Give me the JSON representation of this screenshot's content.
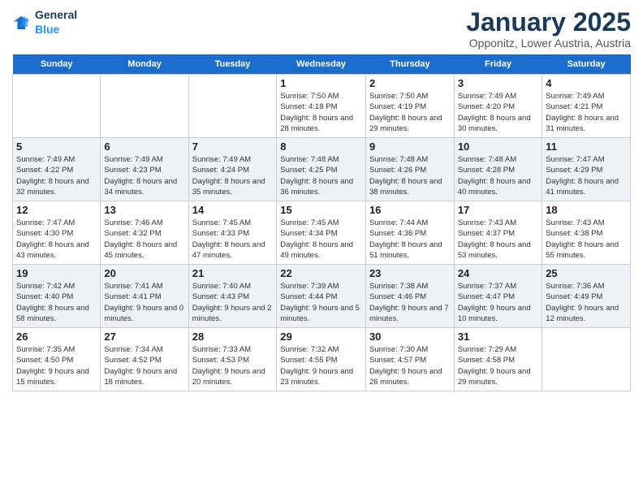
{
  "header": {
    "logo": {
      "general": "General",
      "blue": "Blue"
    },
    "title": "January 2025",
    "subtitle": "Opponitz, Lower Austria, Austria"
  },
  "calendar": {
    "days_of_week": [
      "Sunday",
      "Monday",
      "Tuesday",
      "Wednesday",
      "Thursday",
      "Friday",
      "Saturday"
    ],
    "weeks": [
      [
        {
          "day": "",
          "info": ""
        },
        {
          "day": "",
          "info": ""
        },
        {
          "day": "",
          "info": ""
        },
        {
          "day": "1",
          "info": "Sunrise: 7:50 AM\nSunset: 4:18 PM\nDaylight: 8 hours\nand 28 minutes."
        },
        {
          "day": "2",
          "info": "Sunrise: 7:50 AM\nSunset: 4:19 PM\nDaylight: 8 hours\nand 29 minutes."
        },
        {
          "day": "3",
          "info": "Sunrise: 7:49 AM\nSunset: 4:20 PM\nDaylight: 8 hours\nand 30 minutes."
        },
        {
          "day": "4",
          "info": "Sunrise: 7:49 AM\nSunset: 4:21 PM\nDaylight: 8 hours\nand 31 minutes."
        }
      ],
      [
        {
          "day": "5",
          "info": "Sunrise: 7:49 AM\nSunset: 4:22 PM\nDaylight: 8 hours\nand 32 minutes."
        },
        {
          "day": "6",
          "info": "Sunrise: 7:49 AM\nSunset: 4:23 PM\nDaylight: 8 hours\nand 34 minutes."
        },
        {
          "day": "7",
          "info": "Sunrise: 7:49 AM\nSunset: 4:24 PM\nDaylight: 8 hours\nand 35 minutes."
        },
        {
          "day": "8",
          "info": "Sunrise: 7:48 AM\nSunset: 4:25 PM\nDaylight: 8 hours\nand 36 minutes."
        },
        {
          "day": "9",
          "info": "Sunrise: 7:48 AM\nSunset: 4:26 PM\nDaylight: 8 hours\nand 38 minutes."
        },
        {
          "day": "10",
          "info": "Sunrise: 7:48 AM\nSunset: 4:28 PM\nDaylight: 8 hours\nand 40 minutes."
        },
        {
          "day": "11",
          "info": "Sunrise: 7:47 AM\nSunset: 4:29 PM\nDaylight: 8 hours\nand 41 minutes."
        }
      ],
      [
        {
          "day": "12",
          "info": "Sunrise: 7:47 AM\nSunset: 4:30 PM\nDaylight: 8 hours\nand 43 minutes."
        },
        {
          "day": "13",
          "info": "Sunrise: 7:46 AM\nSunset: 4:32 PM\nDaylight: 8 hours\nand 45 minutes."
        },
        {
          "day": "14",
          "info": "Sunrise: 7:45 AM\nSunset: 4:33 PM\nDaylight: 8 hours\nand 47 minutes."
        },
        {
          "day": "15",
          "info": "Sunrise: 7:45 AM\nSunset: 4:34 PM\nDaylight: 8 hours\nand 49 minutes."
        },
        {
          "day": "16",
          "info": "Sunrise: 7:44 AM\nSunset: 4:36 PM\nDaylight: 8 hours\nand 51 minutes."
        },
        {
          "day": "17",
          "info": "Sunrise: 7:43 AM\nSunset: 4:37 PM\nDaylight: 8 hours\nand 53 minutes."
        },
        {
          "day": "18",
          "info": "Sunrise: 7:43 AM\nSunset: 4:38 PM\nDaylight: 8 hours\nand 55 minutes."
        }
      ],
      [
        {
          "day": "19",
          "info": "Sunrise: 7:42 AM\nSunset: 4:40 PM\nDaylight: 8 hours\nand 58 minutes."
        },
        {
          "day": "20",
          "info": "Sunrise: 7:41 AM\nSunset: 4:41 PM\nDaylight: 9 hours\nand 0 minutes."
        },
        {
          "day": "21",
          "info": "Sunrise: 7:40 AM\nSunset: 4:43 PM\nDaylight: 9 hours\nand 2 minutes."
        },
        {
          "day": "22",
          "info": "Sunrise: 7:39 AM\nSunset: 4:44 PM\nDaylight: 9 hours\nand 5 minutes."
        },
        {
          "day": "23",
          "info": "Sunrise: 7:38 AM\nSunset: 4:46 PM\nDaylight: 9 hours\nand 7 minutes."
        },
        {
          "day": "24",
          "info": "Sunrise: 7:37 AM\nSunset: 4:47 PM\nDaylight: 9 hours\nand 10 minutes."
        },
        {
          "day": "25",
          "info": "Sunrise: 7:36 AM\nSunset: 4:49 PM\nDaylight: 9 hours\nand 12 minutes."
        }
      ],
      [
        {
          "day": "26",
          "info": "Sunrise: 7:35 AM\nSunset: 4:50 PM\nDaylight: 9 hours\nand 15 minutes."
        },
        {
          "day": "27",
          "info": "Sunrise: 7:34 AM\nSunset: 4:52 PM\nDaylight: 9 hours\nand 18 minutes."
        },
        {
          "day": "28",
          "info": "Sunrise: 7:33 AM\nSunset: 4:53 PM\nDaylight: 9 hours\nand 20 minutes."
        },
        {
          "day": "29",
          "info": "Sunrise: 7:32 AM\nSunset: 4:55 PM\nDaylight: 9 hours\nand 23 minutes."
        },
        {
          "day": "30",
          "info": "Sunrise: 7:30 AM\nSunset: 4:57 PM\nDaylight: 9 hours\nand 26 minutes."
        },
        {
          "day": "31",
          "info": "Sunrise: 7:29 AM\nSunset: 4:58 PM\nDaylight: 9 hours\nand 29 minutes."
        },
        {
          "day": "",
          "info": ""
        }
      ]
    ]
  }
}
